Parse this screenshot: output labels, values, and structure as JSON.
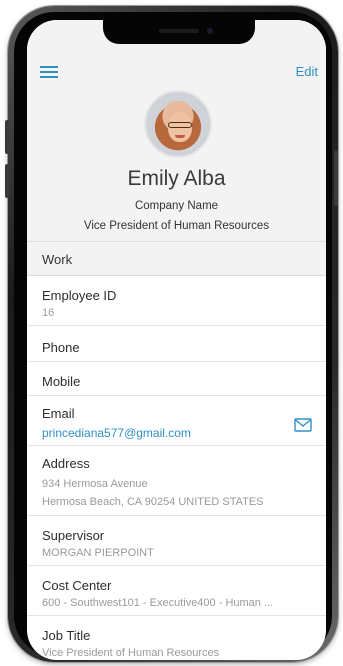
{
  "header": {
    "edit_label": "Edit",
    "name": "Emily Alba",
    "company": "Company Name",
    "job_title": "Vice President of Human Resources"
  },
  "section": {
    "title": "Work"
  },
  "fields": {
    "employee_id": {
      "label": "Employee ID",
      "value": "16"
    },
    "phone": {
      "label": "Phone",
      "value": ""
    },
    "mobile": {
      "label": "Mobile",
      "value": ""
    },
    "email": {
      "label": "Email",
      "value": "princediana577@gmail.com"
    },
    "address": {
      "label": "Address",
      "line1": "934 Hermosa Avenue",
      "line2": "Hermosa Beach, CA 90254 UNITED STATES"
    },
    "supervisor": {
      "label": "Supervisor",
      "value": "MORGAN PIERPOINT"
    },
    "cost_center": {
      "label": "Cost Center",
      "value": "600 - Southwest101 - Executive400 - Human ..."
    },
    "job_title": {
      "label": "Job Title",
      "value": "Vice President of Human Resources"
    }
  },
  "icons": {
    "menu": "hamburger-menu-icon",
    "email": "mail-icon"
  },
  "colors": {
    "accent": "#2f8fc4",
    "header_bg": "#f3f3f3"
  }
}
